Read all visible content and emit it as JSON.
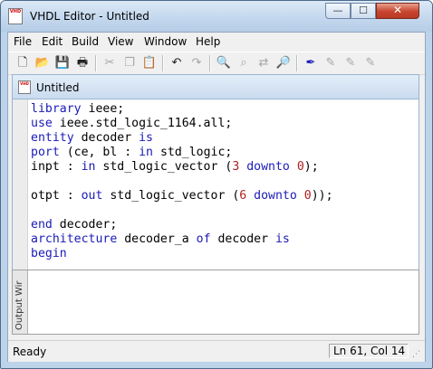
{
  "window": {
    "title": "VHDL Editor - Untitled",
    "minimize_glyph": "—",
    "maximize_glyph": "☐",
    "close_glyph": "✕",
    "app_icon_text": "VHD"
  },
  "menu": {
    "items": [
      "File",
      "Edit",
      "Build",
      "View",
      "Window",
      "Help"
    ]
  },
  "toolbar": {
    "new_glyph": "🗋",
    "open_glyph": "📂",
    "save_glyph": "💾",
    "print_glyph": "🖶",
    "cut_glyph": "✂",
    "copy_glyph": "❐",
    "paste_glyph": "📋",
    "undo_glyph": "↶",
    "redo_glyph": "↷",
    "find_glyph": "🔍",
    "find_next_glyph": "⌕",
    "replace_glyph": "⇄",
    "find_all_glyph": "🔎",
    "build_glyph": "✒",
    "build2_glyph": "✎",
    "build3_glyph": "✎",
    "build4_glyph": "✎"
  },
  "document": {
    "tab_title": "Untitled",
    "icon_text": "VHD",
    "lines": [
      [
        {
          "t": "library",
          "k": "kw"
        },
        {
          "t": " ieee;",
          "k": ""
        }
      ],
      [
        {
          "t": "use",
          "k": "kw"
        },
        {
          "t": " ieee.std_logic_1164.all;",
          "k": ""
        }
      ],
      [
        {
          "t": "entity",
          "k": "kw"
        },
        {
          "t": " decoder ",
          "k": ""
        },
        {
          "t": "is",
          "k": "kw"
        }
      ],
      [
        {
          "t": "port",
          "k": "kw"
        },
        {
          "t": " (ce, bl : ",
          "k": ""
        },
        {
          "t": "in",
          "k": "kw"
        },
        {
          "t": " std_logic;",
          "k": ""
        }
      ],
      [
        {
          "t": "inpt : ",
          "k": ""
        },
        {
          "t": "in",
          "k": "kw"
        },
        {
          "t": " std_logic_vector (",
          "k": ""
        },
        {
          "t": "3",
          "k": "num"
        },
        {
          "t": " ",
          "k": ""
        },
        {
          "t": "downto",
          "k": "kw"
        },
        {
          "t": " ",
          "k": ""
        },
        {
          "t": "0",
          "k": "num"
        },
        {
          "t": ");",
          "k": ""
        }
      ],
      [],
      [
        {
          "t": "otpt : ",
          "k": ""
        },
        {
          "t": "out",
          "k": "kw"
        },
        {
          "t": " std_logic_vector (",
          "k": ""
        },
        {
          "t": "6",
          "k": "num"
        },
        {
          "t": " ",
          "k": ""
        },
        {
          "t": "downto",
          "k": "kw"
        },
        {
          "t": " ",
          "k": ""
        },
        {
          "t": "0",
          "k": "num"
        },
        {
          "t": "));",
          "k": ""
        }
      ],
      [],
      [
        {
          "t": "end",
          "k": "kw"
        },
        {
          "t": " decoder;",
          "k": ""
        }
      ],
      [
        {
          "t": "architecture",
          "k": "kw"
        },
        {
          "t": " decoder_a ",
          "k": ""
        },
        {
          "t": "of",
          "k": "kw"
        },
        {
          "t": " decoder ",
          "k": ""
        },
        {
          "t": "is",
          "k": "kw"
        }
      ],
      [
        {
          "t": "begin",
          "k": "kw"
        }
      ]
    ]
  },
  "output": {
    "tab_label": "Output Wir"
  },
  "status": {
    "text": "Ready",
    "position": "Ln 61, Col 14",
    "grip_glyph": "⋰"
  },
  "colors": {
    "keyword": "#1a1ab8",
    "number": "#b02020",
    "close_button": "#c8442e"
  }
}
